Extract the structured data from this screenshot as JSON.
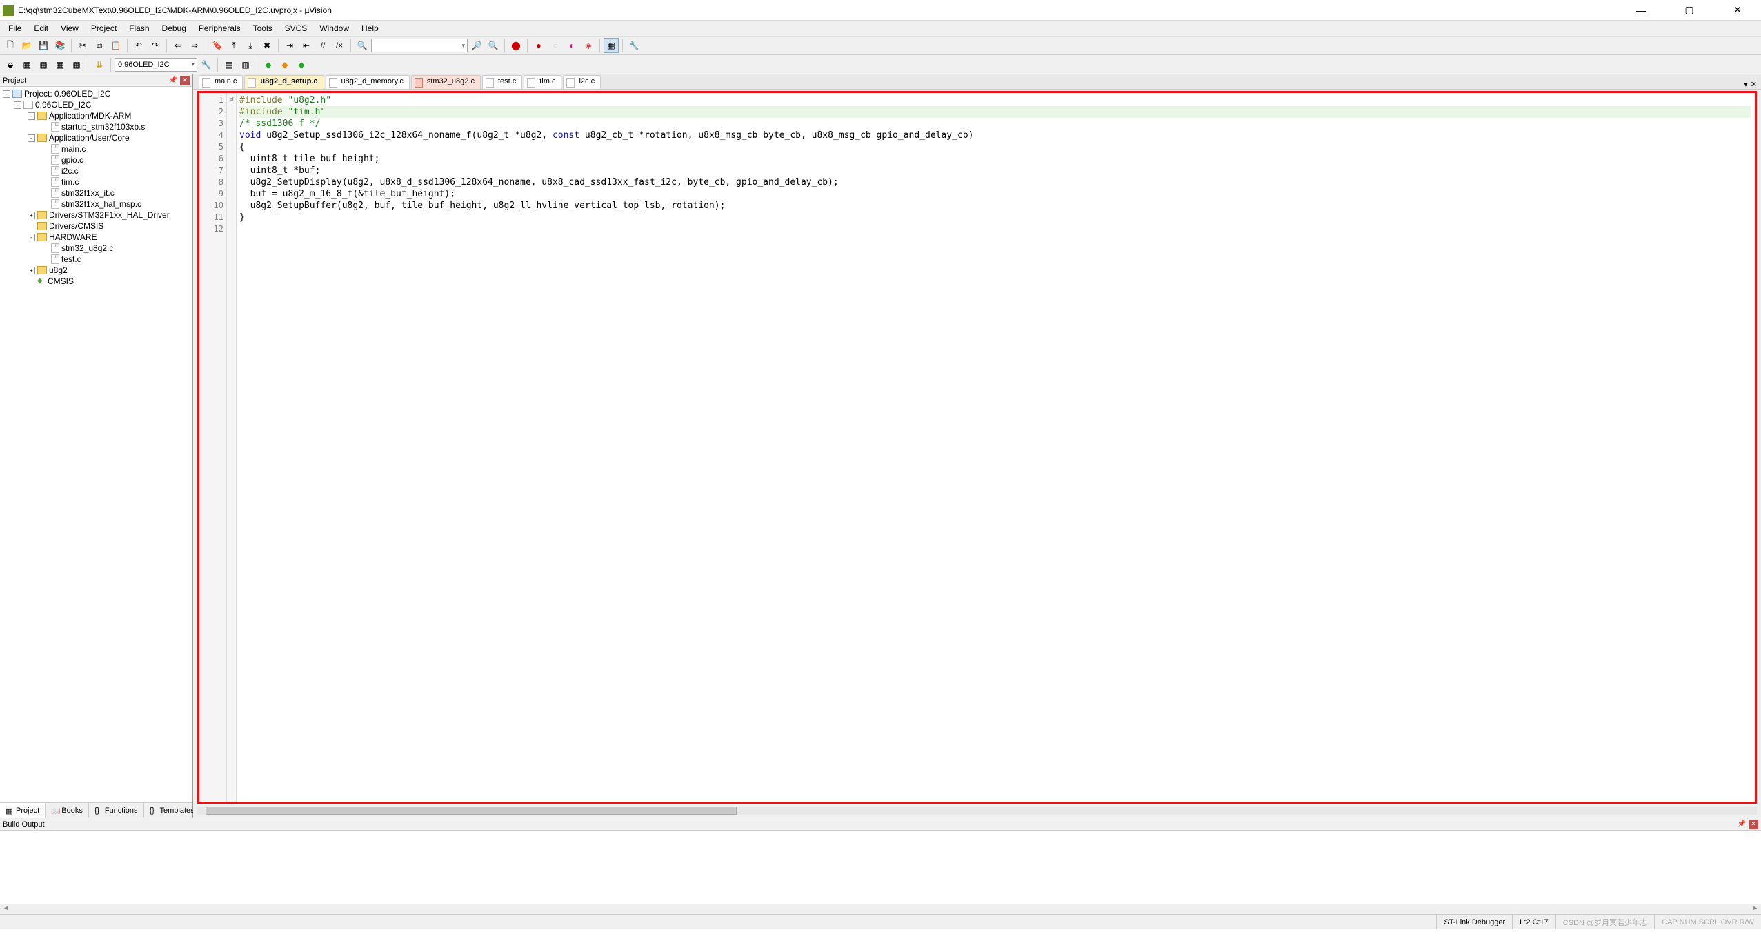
{
  "title": "E:\\qq\\stm32CubeMXText\\0.96OLED_I2C\\MDK-ARM\\0.96OLED_I2C.uvprojx - µVision",
  "menus": [
    "File",
    "Edit",
    "View",
    "Project",
    "Flash",
    "Debug",
    "Peripherals",
    "Tools",
    "SVCS",
    "Window",
    "Help"
  ],
  "target_combo": "0.96OLED_I2C",
  "project_panel": {
    "title": "Project",
    "tabs": [
      "Project",
      "Books",
      "Functions",
      "Templates"
    ],
    "tree": [
      {
        "depth": 0,
        "icon": "prj",
        "expand": "-",
        "label": "Project: 0.96OLED_I2C"
      },
      {
        "depth": 1,
        "icon": "target",
        "expand": "-",
        "label": "0.96OLED_I2C"
      },
      {
        "depth": 2,
        "icon": "folder",
        "expand": "-",
        "label": "Application/MDK-ARM"
      },
      {
        "depth": 3,
        "icon": "file",
        "expand": "",
        "label": "startup_stm32f103xb.s"
      },
      {
        "depth": 2,
        "icon": "folder",
        "expand": "-",
        "label": "Application/User/Core"
      },
      {
        "depth": 3,
        "icon": "file",
        "expand": "",
        "label": "main.c"
      },
      {
        "depth": 3,
        "icon": "file",
        "expand": "",
        "label": "gpio.c"
      },
      {
        "depth": 3,
        "icon": "file",
        "expand": "",
        "label": "i2c.c"
      },
      {
        "depth": 3,
        "icon": "file",
        "expand": "",
        "label": "tim.c"
      },
      {
        "depth": 3,
        "icon": "file",
        "expand": "",
        "label": "stm32f1xx_it.c"
      },
      {
        "depth": 3,
        "icon": "file",
        "expand": "",
        "label": "stm32f1xx_hal_msp.c"
      },
      {
        "depth": 2,
        "icon": "folder",
        "expand": "+",
        "label": "Drivers/STM32F1xx_HAL_Driver"
      },
      {
        "depth": 2,
        "icon": "folder",
        "expand": "",
        "label": "Drivers/CMSIS"
      },
      {
        "depth": 2,
        "icon": "folder",
        "expand": "-",
        "label": "HARDWARE"
      },
      {
        "depth": 3,
        "icon": "file",
        "expand": "",
        "label": "stm32_u8g2.c"
      },
      {
        "depth": 3,
        "icon": "file",
        "expand": "",
        "label": "test.c"
      },
      {
        "depth": 2,
        "icon": "folder",
        "expand": "+",
        "label": "u8g2"
      },
      {
        "depth": 2,
        "icon": "arr",
        "expand": "",
        "label": "CMSIS"
      }
    ]
  },
  "doc_tabs": [
    {
      "label": "main.c",
      "mod": false,
      "active": false
    },
    {
      "label": "u8g2_d_setup.c",
      "mod": false,
      "active": true
    },
    {
      "label": "u8g2_d_memory.c",
      "mod": false,
      "active": false
    },
    {
      "label": "stm32_u8g2.c",
      "mod": true,
      "active": false
    },
    {
      "label": "test.c",
      "mod": false,
      "active": false
    },
    {
      "label": "tim.c",
      "mod": false,
      "active": false
    },
    {
      "label": "i2c.c",
      "mod": false,
      "active": false
    }
  ],
  "code_lines": [
    {
      "n": 1,
      "html": "<span class='pp'>#include</span> <span class='str'>\"u8g2.h\"</span>"
    },
    {
      "n": 2,
      "html": "<span class='hl-line'><span class='pp'>#include</span> <span class='str'>\"tim.h\"</span></span>"
    },
    {
      "n": 3,
      "html": "<span class='cmt'>/* ssd1306 f */</span>"
    },
    {
      "n": 4,
      "html": "<span class='kw'>void</span> u8g2_Setup_ssd1306_i2c_128x64_noname_f(u8g2_t *u8g2, <span class='kw'>const</span> u8g2_cb_t *rotation, u8x8_msg_cb byte_cb, u8x8_msg_cb gpio_and_delay_cb)"
    },
    {
      "n": 5,
      "html": "{"
    },
    {
      "n": 6,
      "html": "  uint8_t tile_buf_height;"
    },
    {
      "n": 7,
      "html": "  uint8_t *buf;"
    },
    {
      "n": 8,
      "html": "  u8g2_SetupDisplay(u8g2, u8x8_d_ssd1306_128x64_noname, u8x8_cad_ssd13xx_fast_i2c, byte_cb, gpio_and_delay_cb);"
    },
    {
      "n": 9,
      "html": "  buf = u8g2_m_16_8_f(&tile_buf_height);"
    },
    {
      "n": 10,
      "html": "  u8g2_SetupBuffer(u8g2, buf, tile_buf_height, u8g2_ll_hvline_vertical_top_lsb, rotation);"
    },
    {
      "n": 11,
      "html": "}"
    },
    {
      "n": 12,
      "html": ""
    }
  ],
  "fold_marks": {
    "5": "⊟"
  },
  "build_output": {
    "title": "Build Output"
  },
  "status": {
    "debugger": "ST-Link Debugger",
    "pos": "L:2 C:17",
    "watermark": "CSDN @岁月冥若少年志",
    "caps": "CAP NUM SCRL OVR R/W"
  }
}
